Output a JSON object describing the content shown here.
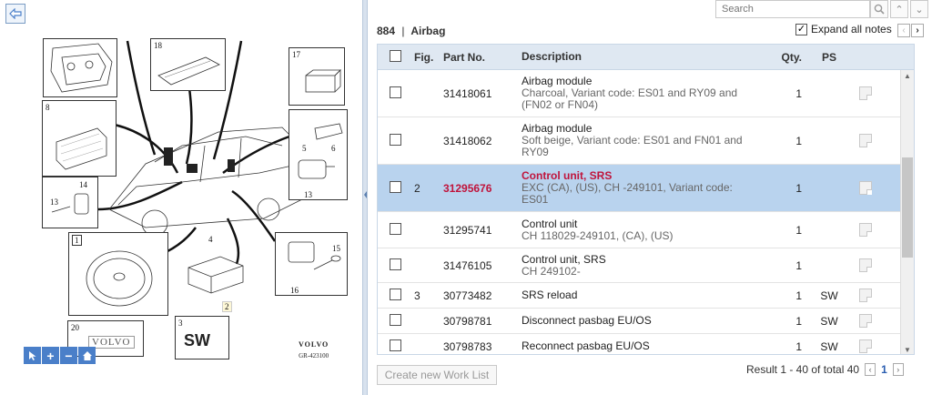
{
  "left": {
    "diagram_numbers": [
      "18",
      "17",
      "8",
      "5",
      "6",
      "13",
      "14",
      "13",
      "1",
      "4",
      "15",
      "2",
      "16",
      "3",
      "20"
    ],
    "sw_label": "SW",
    "caption_brand": "VOLVO",
    "caption_sub": "GR-423100",
    "zoom_icons": [
      "pointer-icon",
      "zoom-in-icon",
      "zoom-out-icon",
      "home-icon"
    ]
  },
  "toolbar": {
    "search_placeholder": "Search"
  },
  "header": {
    "section_code": "884",
    "section_sep": "|",
    "section_name": "Airbag",
    "expand_label": "Expand all notes",
    "expand_checked": true
  },
  "table": {
    "columns": [
      "Fig.",
      "Part No.",
      "Description",
      "Qty.",
      "PS"
    ],
    "rows": [
      {
        "fig": "",
        "part_no": "31418061",
        "title": "Airbag module",
        "sub": "Charcoal, Variant code: ES01 and RY09 and (FN02 or FN04)",
        "qty": "1",
        "ps": "",
        "selected": false
      },
      {
        "fig": "",
        "part_no": "31418062",
        "title": "Airbag module",
        "sub": "Soft beige, Variant code: ES01 and FN01 and RY09",
        "qty": "1",
        "ps": "",
        "selected": false
      },
      {
        "fig": "2",
        "part_no": "31295676",
        "title": "Control unit, SRS",
        "sub": "EXC (CA), (US), CH -249101, Variant code: ES01",
        "qty": "1",
        "ps": "",
        "selected": true
      },
      {
        "fig": "",
        "part_no": "31295741",
        "title": "Control unit",
        "sub": "CH 118029-249101, (CA), (US)",
        "qty": "1",
        "ps": "",
        "selected": false
      },
      {
        "fig": "",
        "part_no": "31476105",
        "title": "Control unit, SRS",
        "sub": "CH 249102-",
        "qty": "1",
        "ps": "",
        "selected": false
      },
      {
        "fig": "3",
        "part_no": "30773482",
        "title": "SRS reload",
        "sub": "",
        "qty": "1",
        "ps": "SW",
        "selected": false
      },
      {
        "fig": "",
        "part_no": "30798781",
        "title": "Disconnect pasbag EU/OS",
        "sub": "",
        "qty": "1",
        "ps": "SW",
        "selected": false
      },
      {
        "fig": "",
        "part_no": "30798783",
        "title": "Reconnect pasbag EU/OS",
        "sub": "",
        "qty": "1",
        "ps": "SW",
        "selected": false
      }
    ]
  },
  "footer": {
    "create_label": "Create new Work List",
    "result_label": "Result 1 - 40 of total 40",
    "page": "1"
  },
  "colors": {
    "selected_row": "#b9d3ee",
    "selected_text": "#c0143c",
    "header_bg": "#dfe8f2",
    "zoom_button": "#4a7fc9"
  }
}
